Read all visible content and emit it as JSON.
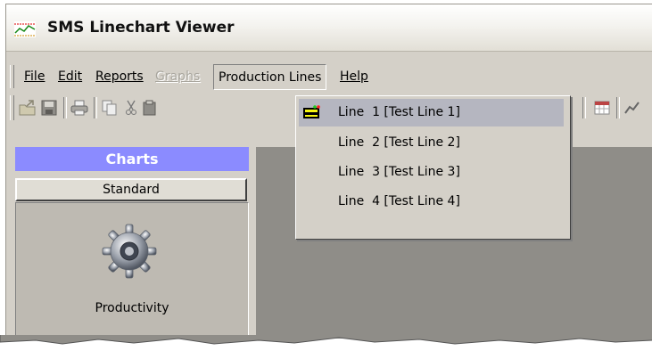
{
  "window": {
    "title": "SMS Linechart Viewer",
    "app_icon": "linechart-icon"
  },
  "menubar": {
    "items": [
      {
        "label": "File",
        "mnemonic_index": 0,
        "state": "enabled"
      },
      {
        "label": "Edit",
        "mnemonic_index": 0,
        "state": "enabled"
      },
      {
        "label": "Reports",
        "mnemonic_index": 0,
        "state": "enabled"
      },
      {
        "label": "Graphs",
        "mnemonic_index": 0,
        "state": "disabled"
      },
      {
        "label": "Production Lines",
        "state": "open"
      },
      {
        "label": "Help",
        "mnemonic_index": 0,
        "state": "enabled"
      }
    ]
  },
  "toolbar": {
    "buttons": [
      "open-icon",
      "save-icon",
      "print-icon",
      "copy-icon",
      "cut-icon",
      "paste-icon",
      "grid-icon",
      "chart-icon"
    ]
  },
  "production_lines_menu": {
    "items": [
      {
        "label": "Line  1 [Test Line 1]",
        "icon": "production-line-icon",
        "selected": true
      },
      {
        "label": "Line  2 [Test Line 2]",
        "selected": false
      },
      {
        "label": "Line  3 [Test Line 3]",
        "selected": false
      },
      {
        "label": "Line  4 [Test Line 4]",
        "selected": false
      }
    ]
  },
  "sidebar": {
    "header": "Charts",
    "group_button": "Standard",
    "items": [
      {
        "label": "Productivity",
        "icon": "gear-icon"
      }
    ]
  },
  "colors": {
    "charts_header": "#8b8bff",
    "menu_highlight": "#b5b6c0",
    "workarea": "#8f8d88"
  }
}
